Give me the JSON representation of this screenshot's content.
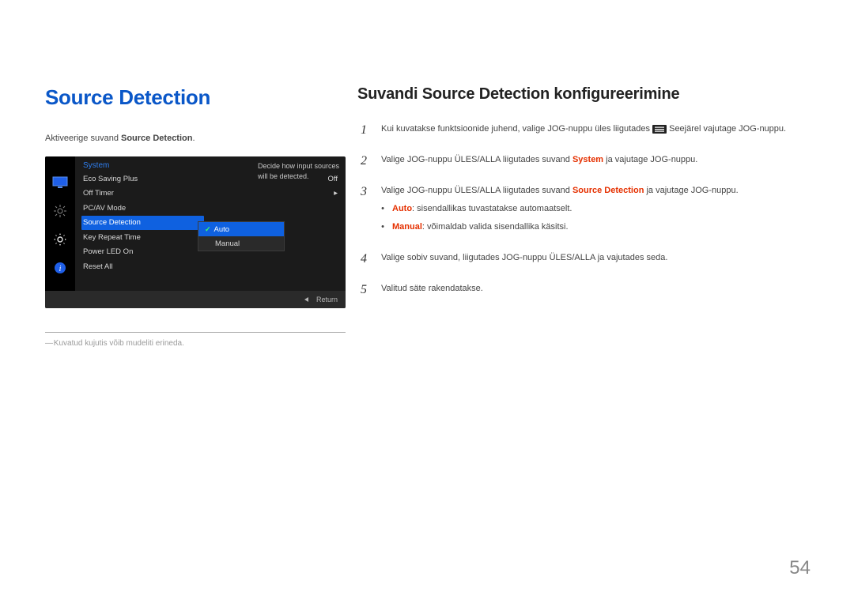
{
  "page_number": "54",
  "left": {
    "title": "Source Detection",
    "intro_prefix": "Aktiveerige suvand ",
    "intro_bold": "Source Detection",
    "intro_suffix": ".",
    "caption": "Kuvatud kujutis võib mudeliti erineda."
  },
  "osd": {
    "header": "System",
    "tooltip": "Decide how input sources will be detected.",
    "items": [
      {
        "label": "Eco Saving Plus",
        "value": "Off"
      },
      {
        "label": "Off Timer",
        "value": "▸"
      },
      {
        "label": "PC/AV Mode",
        "value": ""
      },
      {
        "label": "Source Detection",
        "value": ""
      },
      {
        "label": "Key Repeat Time",
        "value": ""
      },
      {
        "label": "Power LED On",
        "value": ""
      },
      {
        "label": "Reset All",
        "value": ""
      }
    ],
    "submenu": {
      "auto": "Auto",
      "manual": "Manual"
    },
    "footer_return": "Return"
  },
  "right": {
    "title": "Suvandi Source Detection konfigureerimine",
    "steps": {
      "s1_a": "Kui kuvatakse funktsioonide juhend, valige JOG-nuppu üles liigutades ",
      "s1_b": " Seejärel vajutage JOG-nuppu.",
      "s2_a": "Valige JOG-nuppu ÜLES/ALLA liigutades suvand ",
      "s2_red": "System",
      "s2_b": " ja vajutage JOG-nuppu.",
      "s3_a": "Valige JOG-nuppu ÜLES/ALLA liigutades suvand ",
      "s3_red": "Source Detection",
      "s3_b": " ja vajutage JOG-nuppu.",
      "bullet_auto_red": "Auto",
      "bullet_auto_txt": ": sisendallikas tuvastatakse automaatselt.",
      "bullet_manual_red": "Manual",
      "bullet_manual_txt": ": võimaldab valida sisendallika käsitsi.",
      "s4": "Valige sobiv suvand, liigutades JOG-nuppu ÜLES/ALLA ja vajutades seda.",
      "s5": "Valitud säte rakendatakse."
    }
  }
}
